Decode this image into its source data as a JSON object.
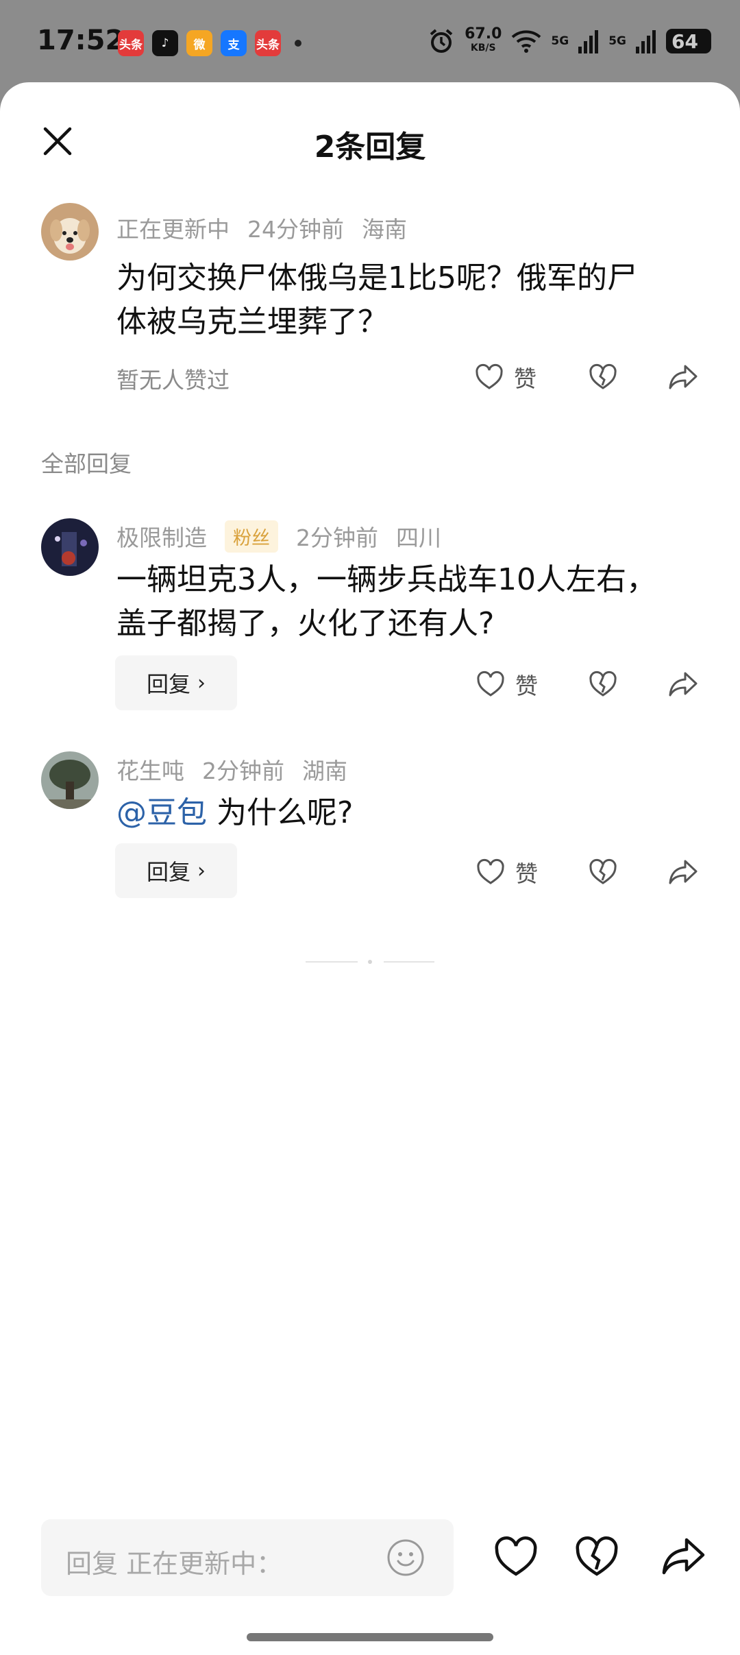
{
  "status_bar": {
    "time": "17:52",
    "apps": [
      {
        "icon": "toutiao-app-icon",
        "label": "头条",
        "color": "#e33b3b"
      },
      {
        "icon": "tiktok-app-icon",
        "label": "♪",
        "color": "#111111"
      },
      {
        "icon": "weibo-app-icon",
        "label": "微",
        "color": "#f5a623"
      },
      {
        "icon": "alipay-app-icon",
        "label": "支",
        "color": "#1677ff"
      },
      {
        "icon": "toutiao-lite-app-icon",
        "label": "头条",
        "color": "#e33b3b"
      }
    ],
    "speed_value": "67.0",
    "speed_unit": "KB/S",
    "net1": "5G",
    "net2": "5G",
    "battery": "64"
  },
  "sheet": {
    "title": "2条回复"
  },
  "main_comment": {
    "username": "正在更新中",
    "time": "24分钟前",
    "location": "海南",
    "text_line1": "为何交换尸体俄乌是1比5呢？俄军的尸",
    "text_line2": "体被乌克兰埋葬了？",
    "likes_text": "暂无人赞过",
    "like_label": "赞"
  },
  "section_label": "全部回复",
  "replies": [
    {
      "username": "极限制造",
      "badge": "粉丝",
      "time": "2分钟前",
      "location": "四川",
      "text_line1": "一辆坦克3人，一辆步兵战车10人左右，",
      "text_line2": "盖子都揭了，火化了还有人?",
      "reply_label": "回复",
      "like_label": "赞"
    },
    {
      "username": "花生吨",
      "time": "2分钟前",
      "location": "湖南",
      "mention": "@豆包",
      "text": " 为什么呢?",
      "reply_label": "回复",
      "like_label": "赞"
    }
  ],
  "composer": {
    "placeholder": "回复 正在更新中："
  }
}
